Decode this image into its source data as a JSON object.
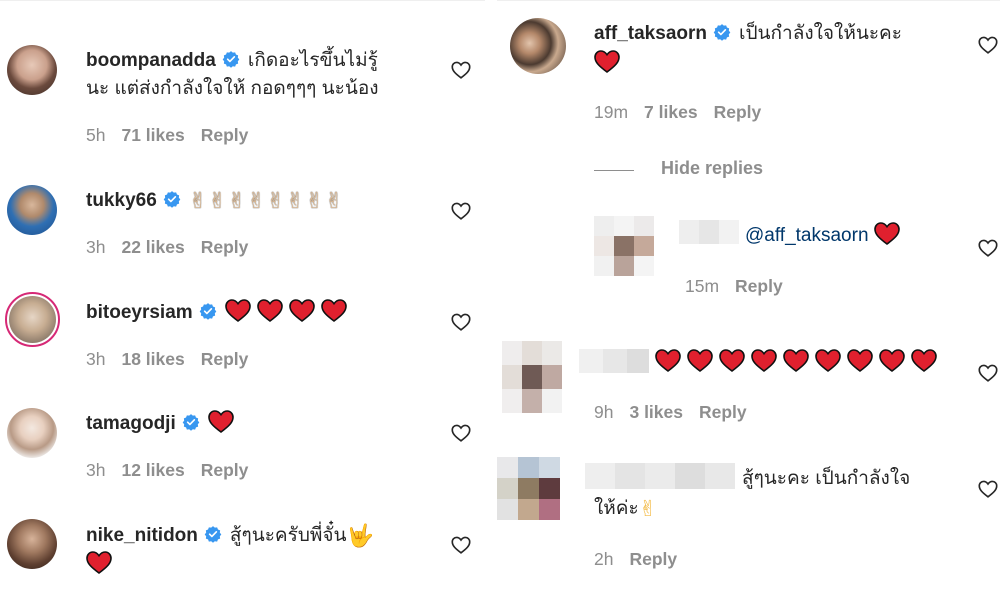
{
  "left_comments": [
    {
      "username": "boompanadda",
      "text_line1": "เกิดอะไรขึ้นไม่รู้",
      "text_line2": "นะ แต่ส่งกำลังใจให้ กอดๆๆๆ นะน้อง",
      "time": "5h",
      "likes": "71 likes",
      "reply": "Reply"
    },
    {
      "username": "tukky66",
      "emoji": "✌✌✌✌✌✌✌✌",
      "time": "3h",
      "likes": "22 likes",
      "reply": "Reply"
    },
    {
      "username": "bitoeyrsiam",
      "heart_count": 4,
      "time": "3h",
      "likes": "18 likes",
      "reply": "Reply"
    },
    {
      "username": "tamagodji",
      "heart_count": 1,
      "time": "3h",
      "likes": "12 likes",
      "reply": "Reply"
    },
    {
      "username": "nike_nitidon",
      "text_line1": "สู้ๆนะครับพี่จั๋น",
      "hand": "🤟",
      "heart_count": 1
    }
  ],
  "right_comments": {
    "main": {
      "username": "aff_taksaorn",
      "text_line1": "เป็นกำลังใจให้นะคะ",
      "time": "19m",
      "likes": "7 likes",
      "reply": "Reply"
    },
    "hide_replies": "Hide replies",
    "reply1": {
      "mention": "@aff_taksaorn",
      "time": "15m",
      "reply": "Reply"
    },
    "c2": {
      "heart_count": 9,
      "time": "9h",
      "likes": "3 likes",
      "reply": "Reply"
    },
    "c3": {
      "text_line1": "สู้ๆนะคะ เป็นกำลังใจ",
      "text_line2": "ให้ค่ะ",
      "hand": "✌",
      "time": "2h",
      "reply": "Reply"
    }
  },
  "colors": {
    "verified": "#3897f0",
    "heart": "#ed4956",
    "meta": "#8e8e8e",
    "mention": "#00376b"
  },
  "icons": {
    "verified": "verified-badge-icon",
    "like": "heart-outline-icon",
    "red_heart": "red-heart-emoji-icon"
  }
}
